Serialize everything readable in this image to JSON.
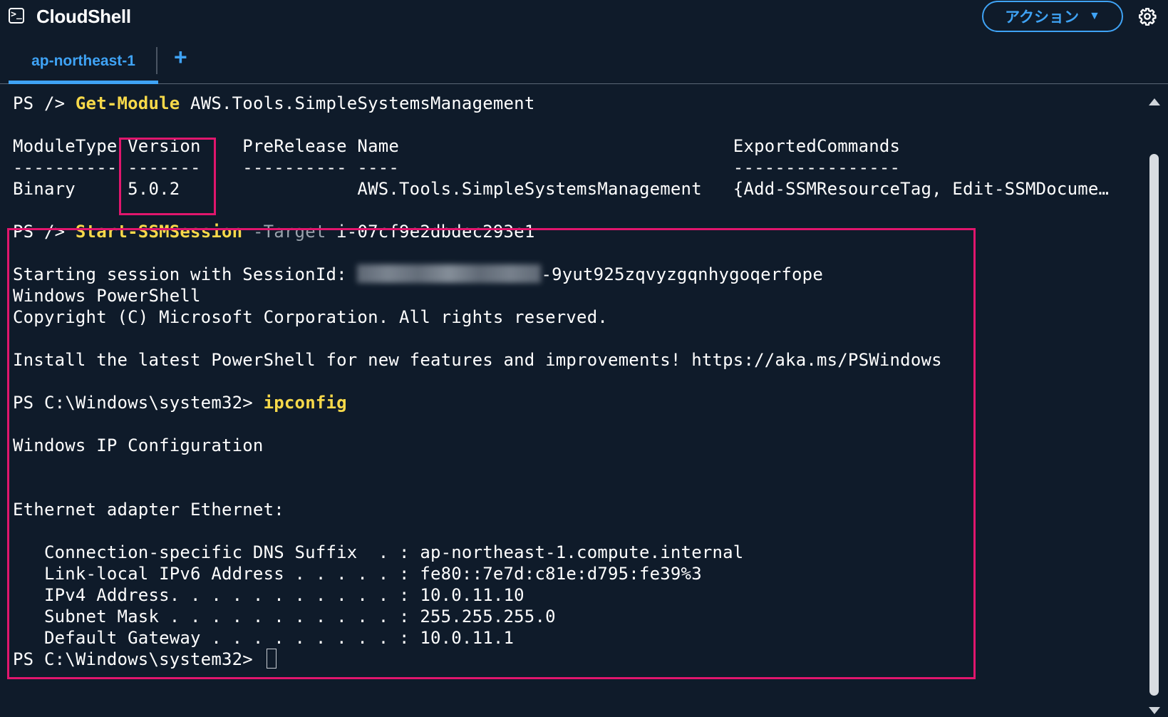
{
  "header": {
    "title": "CloudShell",
    "actions_label": "アクション",
    "caret": "▼"
  },
  "tabs": {
    "active": "ap-northeast-1",
    "add": "+"
  },
  "terminal": {
    "l1": {
      "prompt": "PS /> ",
      "cmd": "Get-Module",
      "rest": " AWS.Tools.SimpleSystemsManagement"
    },
    "l2": "ModuleType Version    PreRelease Name                                ExportedCommands",
    "l3": "---------- -------    ---------- ----                                ----------------",
    "l4": "Binary     5.0.2                 AWS.Tools.SimpleSystemsManagement   {Add-SSMResourceTag, Edit-SSMDocume…",
    "l5": {
      "prompt": "PS /> ",
      "cmd": "Start-SSMSession",
      "param": " -Target",
      "rest": " i-07cf9e2dbdec293e1"
    },
    "l6": {
      "prefix": "Starting session with SessionId: ",
      "suffix": "-9yut925zqvyzgqnhygoqerfope"
    },
    "l7": "Windows PowerShell",
    "l8": "Copyright (C) Microsoft Corporation. All rights reserved.",
    "l9": "Install the latest PowerShell for new features and improvements! https://aka.ms/PSWindows",
    "l10": {
      "prompt": "PS C:\\Windows\\system32> ",
      "cmd": "ipconfig"
    },
    "l11": "Windows IP Configuration",
    "l12": "Ethernet adapter Ethernet:",
    "l13": "   Connection-specific DNS Suffix  . : ap-northeast-1.compute.internal",
    "l14": "   Link-local IPv6 Address . . . . . : fe80::7e7d:c81e:d795:fe39%3",
    "l15": "   IPv4 Address. . . . . . . . . . . : 10.0.11.10",
    "l16": "   Subnet Mask . . . . . . . . . . . : 255.255.255.0",
    "l17": "   Default Gateway . . . . . . . . . : 10.0.11.1",
    "l18": {
      "prompt": "PS C:\\Windows\\system32> "
    }
  },
  "colors": {
    "background": "#0f1b2a",
    "accent": "#3fa3f5",
    "command": "#f7d94a",
    "highlight_box": "#e0166d"
  }
}
